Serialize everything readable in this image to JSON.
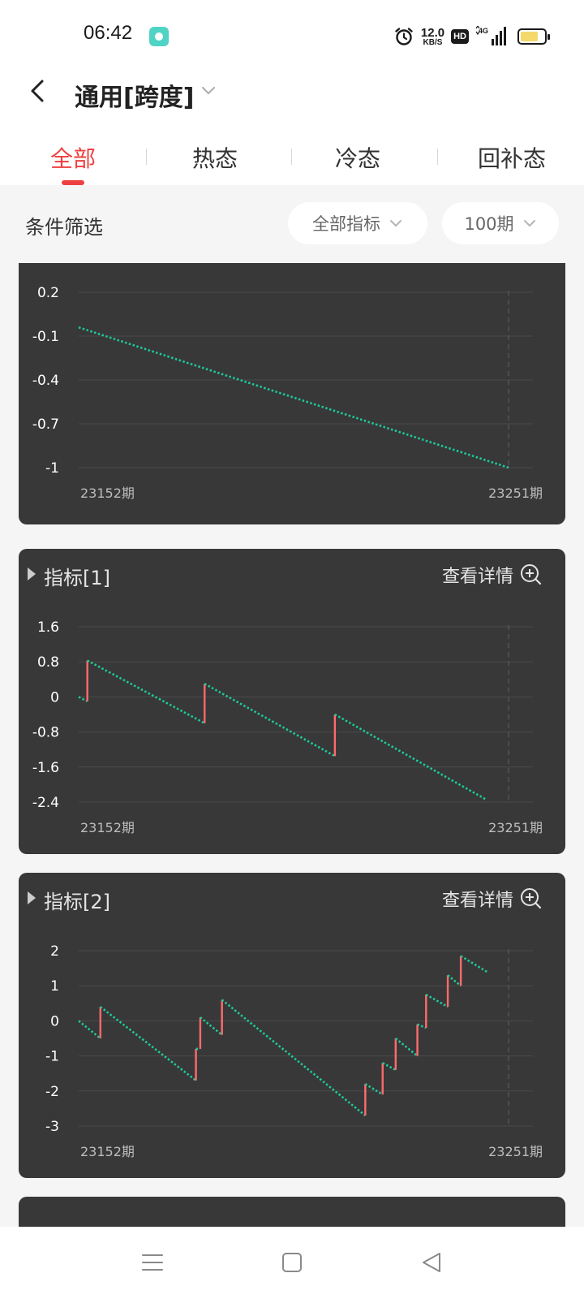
{
  "status_bar": {
    "time": "06:42",
    "net_speed_value": "12.0",
    "net_speed_unit": "KB/S",
    "hd_badge": "HD",
    "network": "4G",
    "battery_level": 0.75,
    "battery_color": "#f5d86b",
    "icons": [
      "app-icon",
      "alarm-icon",
      "signal-icon",
      "battery-icon"
    ]
  },
  "header": {
    "back_icon": "chevron-left-icon",
    "title": "通用[跨度]",
    "title_dropdown_icon": "chevron-down-icon"
  },
  "tabs": [
    {
      "label": "全部",
      "active": true
    },
    {
      "label": "热态",
      "active": false
    },
    {
      "label": "冷态",
      "active": false
    },
    {
      "label": "回补态",
      "active": false
    }
  ],
  "filter": {
    "label": "条件筛选",
    "indicator_select": "全部指标",
    "period_select": "100期"
  },
  "colors": {
    "accent": "#ee4040",
    "card_bg": "#383838",
    "series_down": "#1ec99b",
    "series_up": "#ff6b6b",
    "grid": "#4a4a4a",
    "label": "#ffffff"
  },
  "cards": [
    {
      "title": "",
      "detail_label": "",
      "x_start_label": "23152期",
      "x_end_label": "23251期"
    },
    {
      "title": "指标[1]",
      "detail_label": "查看详情",
      "x_start_label": "23152期",
      "x_end_label": "23251期"
    },
    {
      "title": "指标[2]",
      "detail_label": "查看详情",
      "x_start_label": "23152期",
      "x_end_label": "23251期"
    }
  ],
  "chart_data": [
    {
      "type": "line",
      "title": "",
      "xlabel": "",
      "ylabel": "",
      "x_range": [
        23152,
        23251
      ],
      "yticks": [
        "0.2",
        "-0.1",
        "-0.4",
        "-0.7",
        "-1"
      ],
      "ylim": [
        -1,
        0.2
      ],
      "grid": true,
      "series": [
        {
          "points": [
            [
              0,
              -0.04
            ],
            [
              99,
              -1.0
            ]
          ]
        }
      ]
    },
    {
      "type": "line",
      "title": "",
      "xlabel": "",
      "ylabel": "",
      "x_range": [
        23152,
        23251
      ],
      "yticks": [
        "1.6",
        "0.8",
        "0",
        "-0.8",
        "-1.6",
        "-2.4"
      ],
      "ylim": [
        -2.4,
        1.6
      ],
      "grid": true,
      "series": [
        {
          "points": [
            [
              0,
              0
            ],
            [
              2,
              -0.1
            ],
            [
              2,
              0.83
            ],
            [
              29,
              -0.6
            ],
            [
              29,
              0.3
            ],
            [
              59,
              -1.35
            ],
            [
              59,
              -0.4
            ],
            [
              94,
              -2.35
            ]
          ]
        }
      ]
    },
    {
      "type": "line",
      "title": "",
      "xlabel": "",
      "ylabel": "",
      "x_range": [
        23152,
        23251
      ],
      "yticks": [
        "2",
        "1",
        "0",
        "-1",
        "-2",
        "-3"
      ],
      "ylim": [
        -3,
        2
      ],
      "grid": true,
      "series": [
        {
          "points": [
            [
              0,
              0
            ],
            [
              5,
              -0.5
            ],
            [
              5,
              0.4
            ],
            [
              27,
              -1.7
            ],
            [
              27,
              -0.8
            ],
            [
              28,
              -0.8
            ],
            [
              28,
              0.1
            ],
            [
              33,
              -0.4
            ],
            [
              33,
              0.6
            ],
            [
              66,
              -2.7
            ],
            [
              66,
              -1.8
            ],
            [
              70,
              -2.1
            ],
            [
              70,
              -1.2
            ],
            [
              73,
              -1.4
            ],
            [
              73,
              -0.5
            ],
            [
              78,
              -1.0
            ],
            [
              78,
              -0.1
            ],
            [
              80,
              -0.2
            ],
            [
              80,
              0.75
            ],
            [
              85,
              0.4
            ],
            [
              85,
              1.3
            ],
            [
              88,
              1.0
            ],
            [
              88,
              1.85
            ],
            [
              94,
              1.4
            ]
          ]
        }
      ]
    }
  ],
  "nav_bar": {
    "icons": [
      "menu-icon",
      "home-square-icon",
      "back-triangle-icon"
    ]
  }
}
